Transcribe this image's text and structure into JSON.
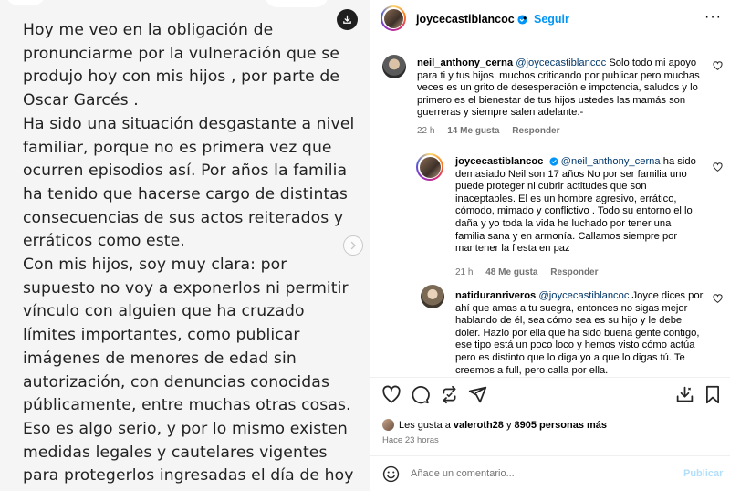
{
  "media": {
    "paragraphs": [
      "Hoy me veo en la obligación de pronunciarme por la vulneración que se produjo hoy con mis hijos , por parte de Oscar Garcés .",
      "Ha sido una situación desgastante a nivel familiar, porque no es primera vez que ocurren episodios así. Por años  la familia ha tenido que hacerse cargo de distintas consecuencias de sus actos reiterados y erráticos como este.",
      "Con mis hijos, soy muy clara: por supuesto no voy a exponerlos ni permitir vínculo con alguien que ha cruzado límites importantes, como publicar imágenes de menores de edad sin autorización, con denuncias conocidas públicamente, entre muchas otras cosas. Eso es algo serio, y por lo mismo existen medidas legales y cautelares vigentes para protegerlos ingresadas el día de hoy ."
    ]
  },
  "header": {
    "username": "joycecastiblancoc",
    "separator": "•",
    "follow_label": "Seguir",
    "more_label": "···"
  },
  "comments": [
    {
      "username": "neil_anthony_cerna",
      "mention": "@joycecastiblancoc",
      "text": " Solo todo mi apoyo para ti y tus hijos, muchos criticando por publicar pero muchas veces es un grito de desesperación e impotencia, saludos y lo primero es el bienestar de tus hijos ustedes las mamás son guerreras y siempre salen adelante.-",
      "time": "22 h",
      "likes": "14 Me gusta",
      "reply": "Responder"
    },
    {
      "username": "joycecastiblancoc",
      "mention": "@neil_anthony_cerna",
      "text": " ha sido demasiado Neil son 17 años No por ser familia uno puede proteger ni cubrir actitudes que son inaceptables. El es un hombre agresivo, errático, cómodo, mimado y conflictivo . Todo su entorno el lo daña y yo toda la vida he luchado por tener una familia sana y en armonía. Callamos siempre por mantener la fiesta en paz",
      "time": "21 h",
      "likes": "48 Me gusta",
      "reply": "Responder"
    },
    {
      "username": "natiduranriveros",
      "mention": "@joycecastiblancoc",
      "text": " Joyce dices por ahí que amas a tu suegra, entonces no sigas mejor hablando de él, sea cómo sea es su hijo y le debe doler. Hazlo por ella que ha sido buena gente contigo, ese tipo está un poco loco y hemos visto cómo actúa pero es distinto que lo diga yo a que lo digas tú. Te creemos a full, pero calla por ella."
    }
  ],
  "likes": {
    "prefix": "Les gusta a ",
    "user": "valeroth28",
    "middle": " y ",
    "count": "8905 personas más"
  },
  "time_ago": "Hace 23 horas",
  "add_comment": {
    "placeholder": "Añade un comentario...",
    "publish_label": "Publicar"
  },
  "colors": {
    "accent": "#0095f6",
    "mention": "#00376b",
    "muted": "#737373",
    "publish_disabled": "#b2dffc"
  }
}
